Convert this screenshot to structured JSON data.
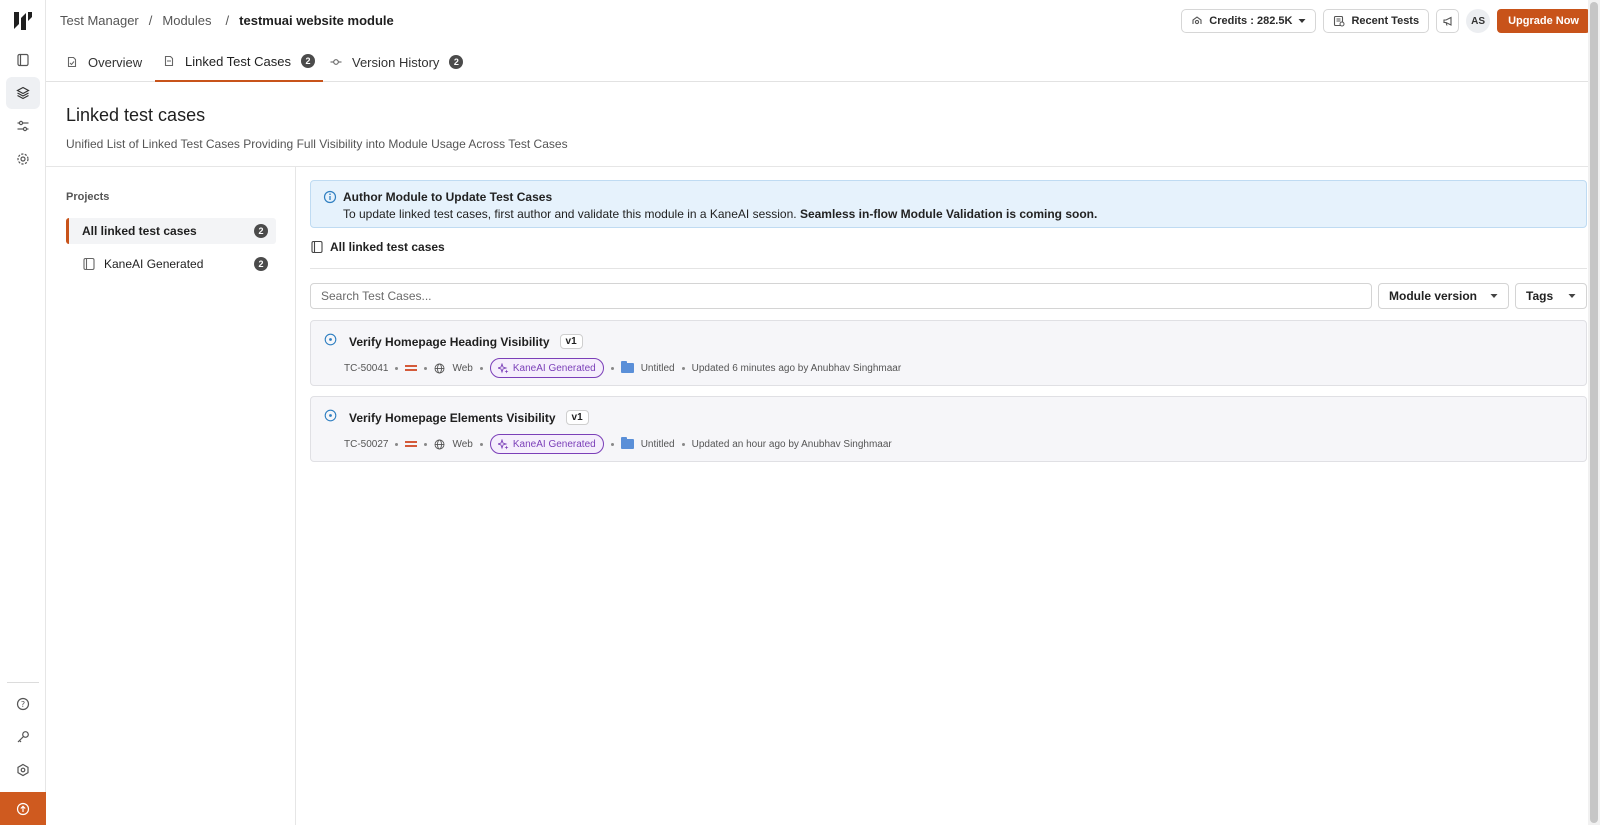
{
  "breadcrumb": {
    "root": "Test Manager",
    "section": "Modules",
    "current": "testmuai website module",
    "separator": "/"
  },
  "topbar": {
    "credits_label": "Credits : 282.5K",
    "recent_tests_label": "Recent Tests",
    "avatar_initials": "AS",
    "upgrade_label": "Upgrade Now"
  },
  "tabs": [
    {
      "label": "Overview",
      "badge": null
    },
    {
      "label": "Linked Test Cases",
      "badge": "2"
    },
    {
      "label": "Version History",
      "badge": "2"
    }
  ],
  "page": {
    "title": "Linked test cases",
    "subtitle": "Unified List of Linked Test Cases Providing Full Visibility into Module Usage Across Test Cases"
  },
  "projects": {
    "heading": "Projects",
    "items": [
      {
        "label": "All linked test cases",
        "count": "2"
      },
      {
        "label": "KaneAI Generated",
        "count": "2"
      }
    ]
  },
  "banner": {
    "title": "Author Module to Update Test Cases",
    "text": "To update linked test cases, first author and validate this module in a KaneAI session.",
    "emphasis": "Seamless in-flow Module Validation is coming soon."
  },
  "list": {
    "heading": "All linked test cases",
    "search_placeholder": "Search Test Cases...",
    "filter_version": "Module version",
    "filter_tags": "Tags"
  },
  "test_cases": [
    {
      "title": "Verify Homepage Heading Visibility",
      "version": "v1",
      "id": "TC-50041",
      "platform": "Web",
      "tag": "KaneAI Generated",
      "folder": "Untitled",
      "updated": "Updated 6 minutes ago by Anubhav Singhmaar"
    },
    {
      "title": "Verify Homepage Elements Visibility",
      "version": "v1",
      "id": "TC-50027",
      "platform": "Web",
      "tag": "KaneAI Generated",
      "folder": "Untitled",
      "updated": "Updated an hour ago by Anubhav Singhmaar"
    }
  ],
  "colors": {
    "accent": "#c8531a",
    "info_bg": "#e6f2fc",
    "tag_purple": "#7b3fb8"
  }
}
